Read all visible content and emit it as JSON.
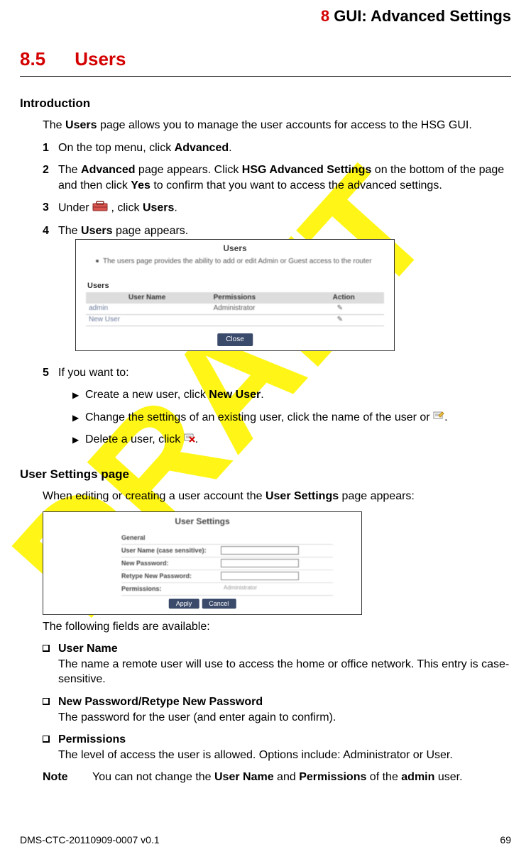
{
  "header": {
    "chapter_num": "8",
    "chapter_title": "GUI: Advanced Settings"
  },
  "section": {
    "number": "8.5",
    "title": "Users"
  },
  "intro": {
    "heading": "Introduction",
    "lead_pre": "The ",
    "lead_b": "Users",
    "lead_post": " page allows you to manage the user accounts for access to the HSG GUI.",
    "steps": {
      "s1": {
        "n": "1",
        "t1": "On the top menu, click ",
        "b1": "Advanced",
        "t2": "."
      },
      "s2": {
        "n": "2",
        "t1": "The ",
        "b1": "Advanced",
        "t2": " page appears. Click ",
        "b2": "HSG Advanced Settings",
        "t3": " on the bottom of the page and then click ",
        "b3": "Yes",
        "t4": " to confirm that you want to access the advanced settings."
      },
      "s3": {
        "n": "3",
        "t1": "Under ",
        "t2": ", click ",
        "b1": "Users",
        "t3": "."
      },
      "s4": {
        "n": "4",
        "t1": "The ",
        "b1": "Users",
        "t2": " page appears."
      },
      "s5": {
        "n": "5",
        "t1": "If you want to:",
        "sub": {
          "a": {
            "t1": "Create a new user, click ",
            "b1": "New User",
            "t2": "."
          },
          "b": {
            "t1": "Change the settings of an existing user, click the name of the user or ",
            "t2": "."
          },
          "c": {
            "t1": "Delete a user, click ",
            "t2": "."
          }
        }
      }
    }
  },
  "shot1": {
    "title": "Users",
    "desc": "The users page provides the ability to add or edit Admin or Guest access to the router",
    "subhead": "Users",
    "hdr1": "User Name",
    "hdr2": "Permissions",
    "hdr3": "Action",
    "r1c1": "admin",
    "r1c2": "Administrator",
    "r2c1": "New User",
    "close": "Close"
  },
  "usersettings": {
    "heading": "User Settings page",
    "lead_t1": "When editing or creating a user account the ",
    "lead_b": "User Settings",
    "lead_t2": " page appears:",
    "fields_intro": "The following fields are available:",
    "f1_title": "User Name",
    "f1_desc": "The name a remote user will use to access the home or office network. This entry is case-sensitive.",
    "f2_title": "New Password/Retype New Password",
    "f2_desc": "The password for the user (and enter again to confirm).",
    "f3_title": "Permissions",
    "f3_desc": "The level of access the user is allowed. Options include: Administrator or User.",
    "note_label": "Note",
    "note_t1": "You can not change the ",
    "note_b1": "User Name",
    "note_t2": " and ",
    "note_b2": "Permissions",
    "note_t3": " of the ",
    "note_b3": "admin",
    "note_t4": " user."
  },
  "shot2": {
    "title": "User Settings",
    "l_general": "General",
    "l_user": "User Name   (case sensitive):",
    "l_pass": "New Password:",
    "l_rpass": "Retype New Password:",
    "l_perm": "Permissions:",
    "perm_val": "Administrator",
    "btn_apply": "Apply",
    "btn_cancel": "Cancel"
  },
  "footer": {
    "doc": "DMS-CTC-20110909-0007 v0.1",
    "page": "69"
  }
}
